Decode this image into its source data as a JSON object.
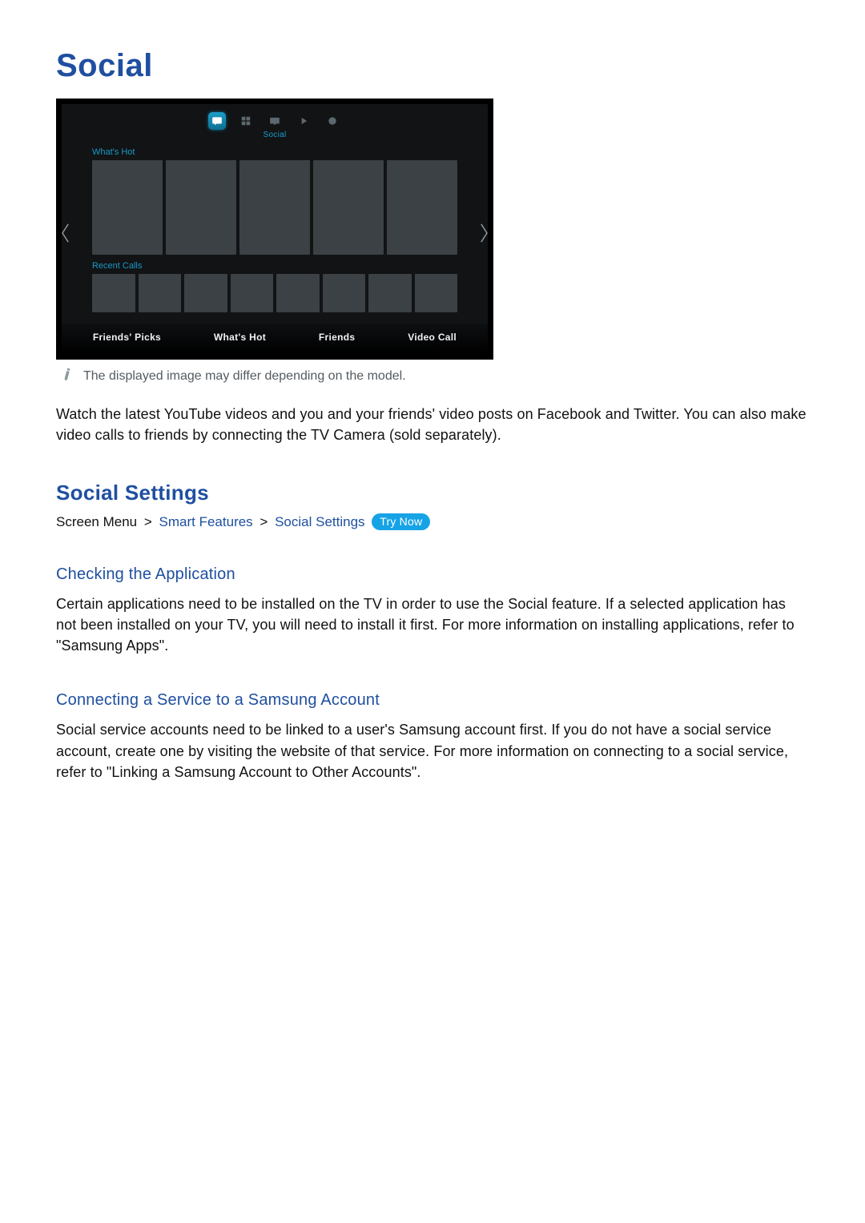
{
  "page": {
    "title": "Social"
  },
  "tv": {
    "icon_label": "Social",
    "sec_whats_hot": "What's Hot",
    "sec_recent_calls": "Recent Calls",
    "bottom_nav": {
      "friends_picks": "Friends' Picks",
      "whats_hot": "What's Hot",
      "friends": "Friends",
      "video_call": "Video Call"
    }
  },
  "note": {
    "text": "The displayed image may differ depending on the model."
  },
  "intro": {
    "text": "Watch the latest YouTube videos and you and your friends' video posts on Facebook and Twitter. You can also make video calls to friends by connecting the TV Camera (sold separately)."
  },
  "settings": {
    "title": "Social Settings",
    "breadcrumb": {
      "root": "Screen Menu",
      "a": "Smart Features",
      "b": "Social Settings",
      "try_now": "Try Now"
    }
  },
  "checking": {
    "title": "Checking the Application",
    "text": "Certain applications need to be installed on the TV in order to use the Social feature. If a selected application has not been installed on your TV, you will need to install it first. For more information on installing applications, refer to \"Samsung Apps\"."
  },
  "connecting": {
    "title": "Connecting a Service to a Samsung Account",
    "text": "Social service accounts need to be linked to a user's Samsung account first. If you do not have a social service account, create one by visiting the website of that service. For more information on connecting to a social service, refer to \"Linking a Samsung Account to Other Accounts\"."
  }
}
